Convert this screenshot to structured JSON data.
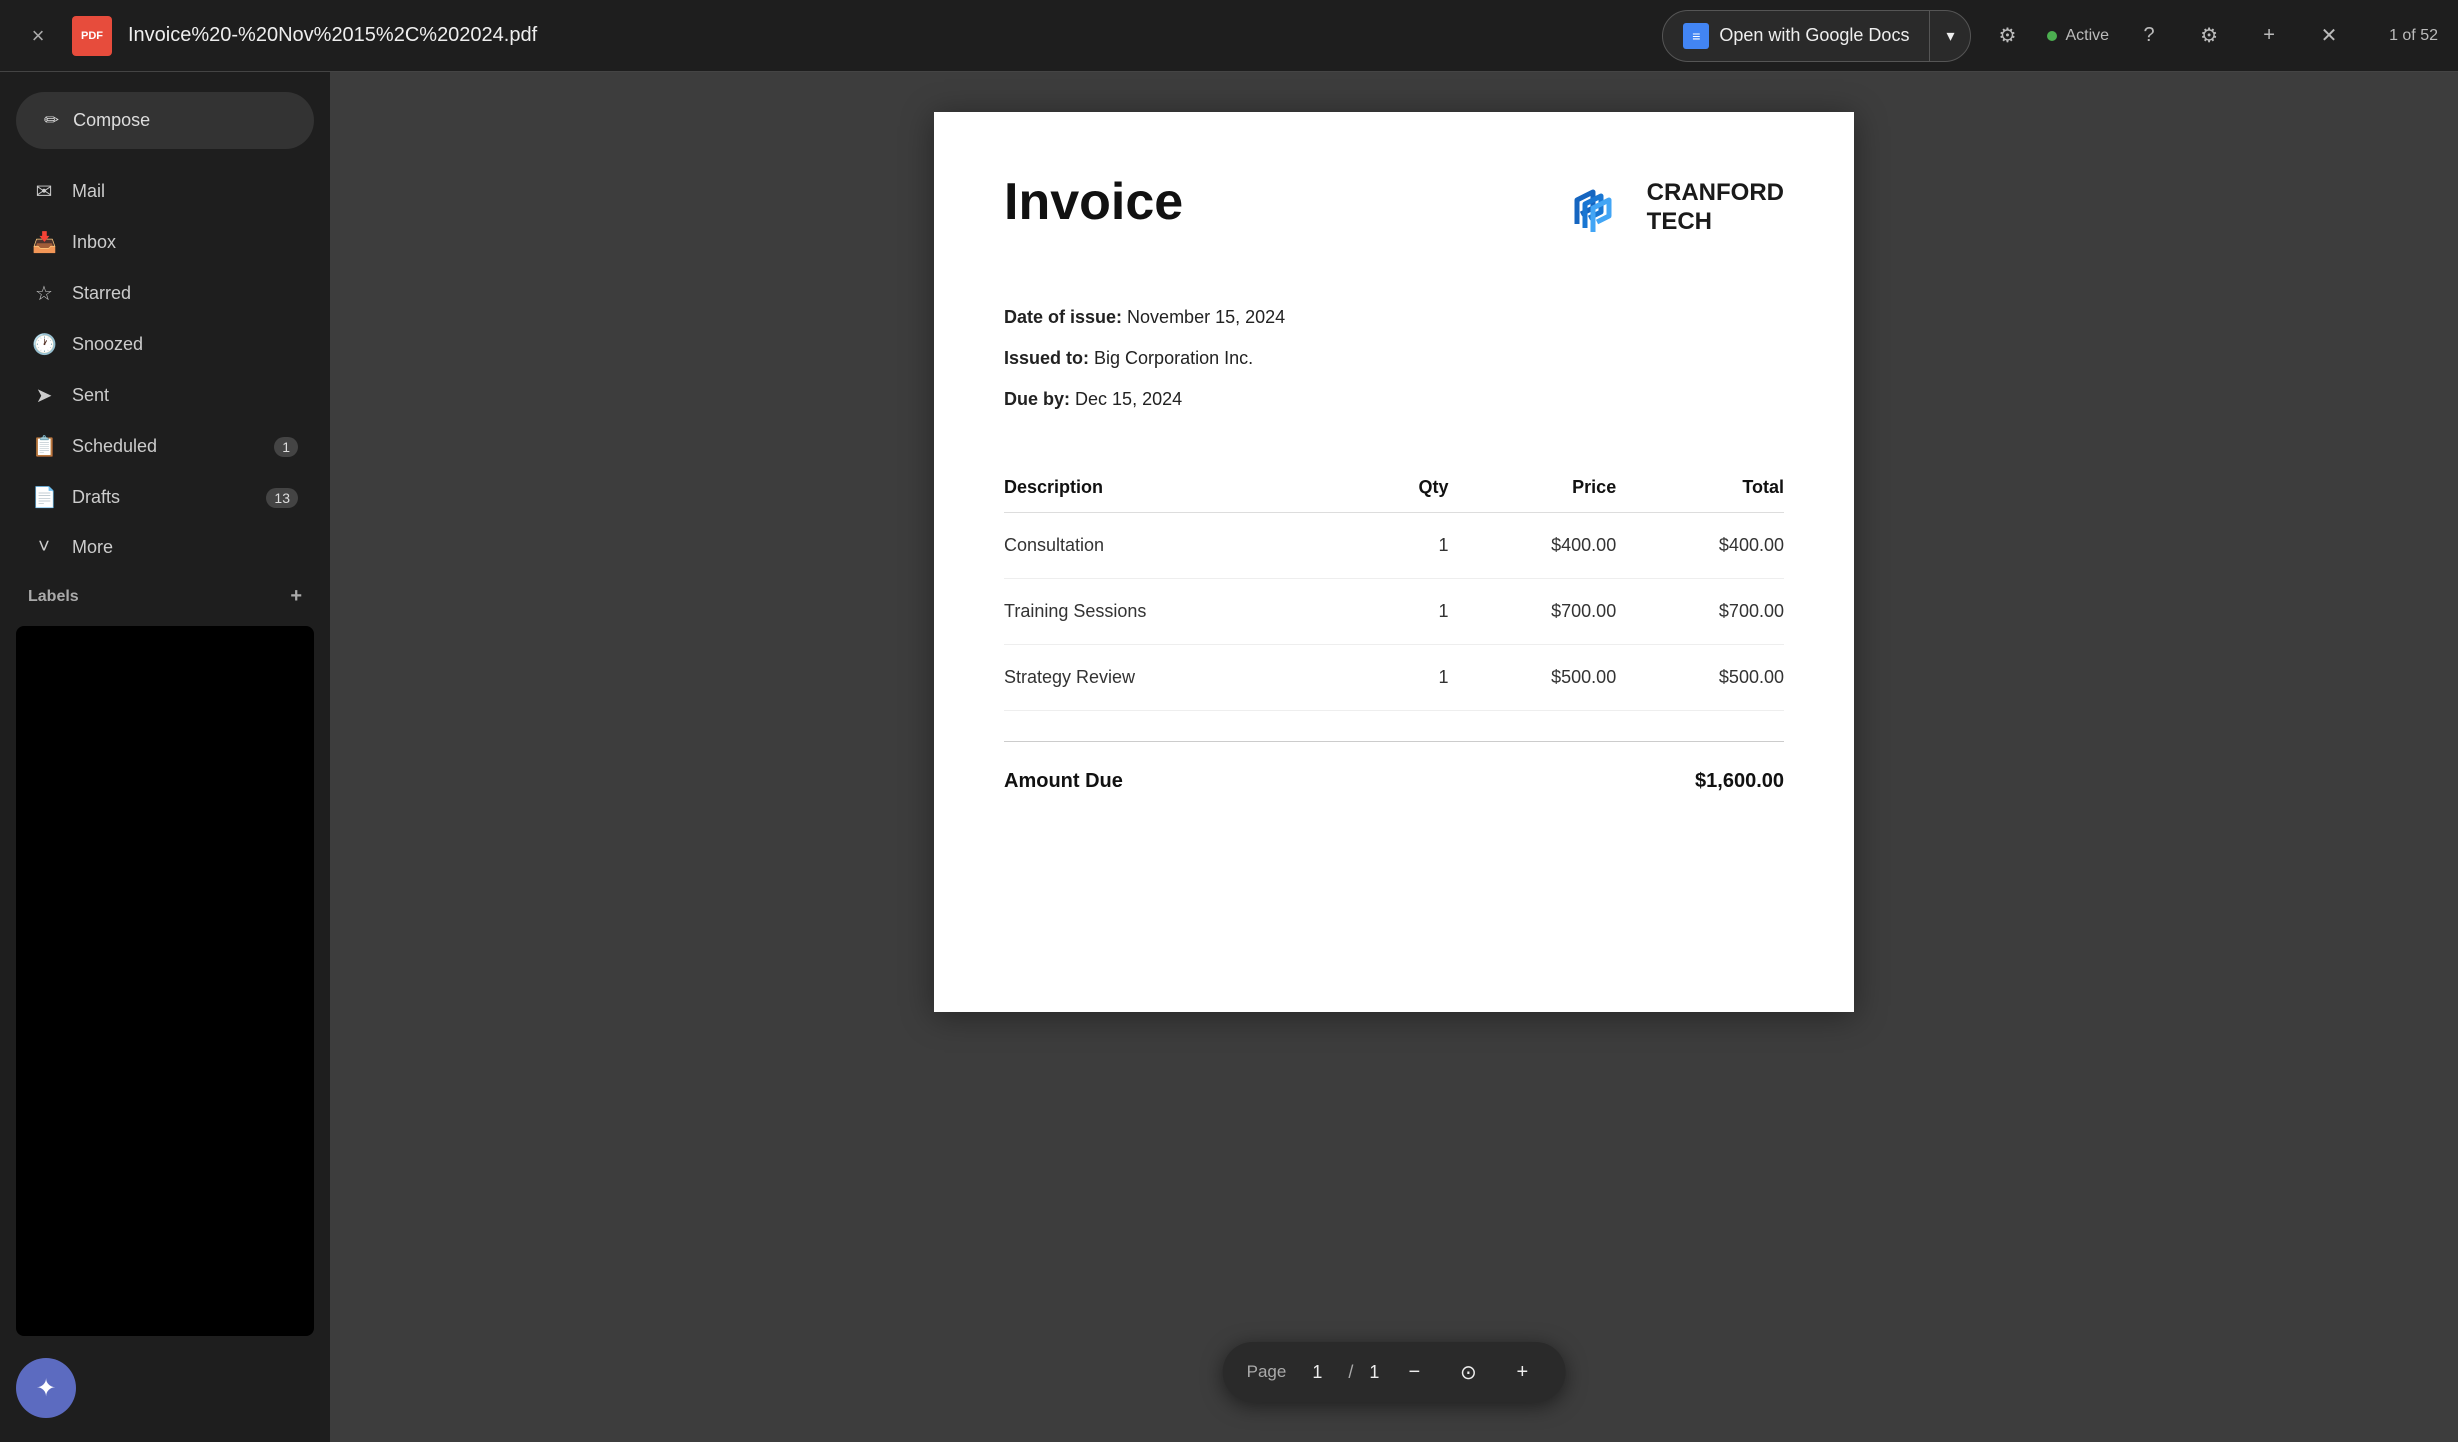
{
  "topbar": {
    "close_label": "×",
    "pdf_icon": "PDF",
    "file_name": "Invoice%20-%20Nov%2015%2C%202024.pdf",
    "open_with_label": "Open with Google Docs",
    "arrow": "▾",
    "active_label": "Active",
    "page_counter": "1 of 52"
  },
  "sidebar": {
    "compose_label": "Compose",
    "compose_icon": "✏",
    "items": [
      {
        "id": "mail",
        "icon": "✉",
        "label": "Mail"
      },
      {
        "id": "inbox",
        "icon": "📥",
        "label": "Inbox"
      },
      {
        "id": "starred",
        "icon": "☆",
        "label": "Starred"
      },
      {
        "id": "snoozed",
        "icon": "🕐",
        "label": "Snoozed"
      },
      {
        "id": "sent",
        "icon": "➤",
        "label": "Sent"
      },
      {
        "id": "scheduled",
        "icon": "📋",
        "label": "Scheduled",
        "badge": "1"
      },
      {
        "id": "drafts",
        "icon": "📄",
        "label": "Drafts",
        "badge": "13"
      },
      {
        "id": "more",
        "icon": "˅",
        "label": "More"
      }
    ],
    "labels_section": "Labels",
    "labels_add": "+"
  },
  "invoice": {
    "title": "Invoice",
    "company_name": "CRANFORD\nTECH",
    "date_of_issue_label": "Date of issue:",
    "date_of_issue_value": "November 15, 2024",
    "issued_to_label": "Issued to:",
    "issued_to_value": "Big Corporation Inc.",
    "due_by_label": "Due by:",
    "due_by_value": "Dec 15, 2024",
    "table_headers": [
      "Description",
      "Qty",
      "Price",
      "Total"
    ],
    "table_rows": [
      {
        "description": "Consultation",
        "qty": "1",
        "price": "$400.00",
        "total": "$400.00"
      },
      {
        "description": "Training Sessions",
        "qty": "1",
        "price": "$700.00",
        "total": "$700.00"
      },
      {
        "description": "Strategy Review",
        "qty": "1",
        "price": "$500.00",
        "total": "$500.00"
      }
    ],
    "amount_due_label": "Amount Due",
    "amount_due_value": "$1,600.00"
  },
  "page_controls": {
    "page_label": "Page",
    "current_page": "1",
    "slash": "/",
    "total_pages": "1",
    "zoom_out": "−",
    "zoom_in": "+"
  },
  "colors": {
    "accent_blue": "#4285f4",
    "logo_blue": "#1565c0",
    "active_green": "#4caf50"
  }
}
